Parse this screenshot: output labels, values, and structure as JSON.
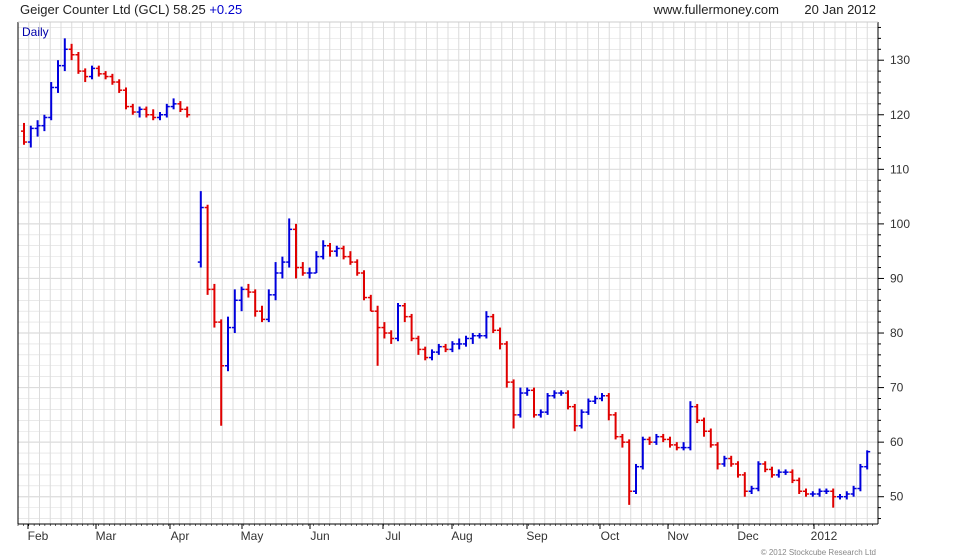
{
  "header": {
    "title": "Geiger Counter Ltd (GCL) 58.25",
    "change": "+0.25",
    "site": "www.fullermoney.com",
    "date": "20 Jan 2012"
  },
  "period_label": "Daily",
  "copyright": "© 2012 Stockcube Research Ltd",
  "colors": {
    "up": "#0000dd",
    "down": "#e00000",
    "grid": "#dcdcdc",
    "axis": "#000000",
    "label": "#0000aa"
  },
  "chart_data": {
    "type": "line",
    "style": "ohlc-bars",
    "period": "Daily",
    "x_tick_labels": [
      "Feb",
      "Mar",
      "Apr",
      "May",
      "Jun",
      "Jul",
      "Aug",
      "Sep",
      "Oct",
      "Nov",
      "Dec",
      "2012"
    ],
    "y_ticks": [
      50,
      60,
      70,
      80,
      90,
      100,
      110,
      120,
      130
    ],
    "ylim": [
      45,
      137
    ],
    "grid": true,
    "series": [
      {
        "values": [
          [
            0,
            117,
            118.5,
            114.5,
            115
          ],
          [
            1,
            115,
            118,
            114,
            117.5
          ],
          [
            2,
            117.5,
            119,
            116,
            118
          ],
          [
            3,
            118,
            120,
            117,
            119.5
          ],
          [
            4,
            119.5,
            126,
            119,
            125
          ],
          [
            5,
            125,
            130,
            124,
            129
          ],
          [
            6,
            129,
            134,
            128,
            132
          ],
          [
            7,
            132,
            133,
            130,
            131
          ],
          [
            8,
            131,
            131.5,
            127.5,
            128
          ],
          [
            9,
            128,
            128.5,
            126,
            127
          ],
          [
            10,
            127,
            129,
            126.5,
            128.5
          ],
          [
            11,
            128.5,
            129,
            127,
            127.5
          ],
          [
            12,
            127.5,
            128,
            126.5,
            127
          ],
          [
            13,
            127,
            127.5,
            125.5,
            126
          ],
          [
            14,
            126,
            126.5,
            124,
            124.5
          ],
          [
            15,
            124.5,
            125,
            121,
            121.5
          ],
          [
            16,
            121.5,
            122,
            120,
            120.5
          ],
          [
            17,
            120.5,
            121.5,
            119.5,
            121
          ],
          [
            18,
            121,
            121.5,
            119.5,
            120
          ],
          [
            19,
            120,
            121,
            119,
            119.5
          ],
          [
            20,
            119.5,
            120.5,
            119,
            120
          ],
          [
            21,
            120,
            122,
            119.5,
            121.5
          ],
          [
            22,
            121.5,
            123,
            121,
            122
          ],
          [
            23,
            122,
            122.5,
            120.5,
            121
          ],
          [
            24,
            121,
            121.5,
            119.5,
            120
          ],
          [
            26,
            93,
            106,
            92,
            103
          ],
          [
            27,
            103,
            103.5,
            87,
            88
          ],
          [
            28,
            88,
            89,
            81,
            82
          ],
          [
            29,
            82,
            82.5,
            63,
            74
          ],
          [
            30,
            74,
            83,
            73,
            81
          ],
          [
            31,
            81,
            88,
            80,
            86
          ],
          [
            32,
            86,
            88.5,
            84,
            88
          ],
          [
            33,
            88,
            89,
            86.5,
            87.5
          ],
          [
            34,
            87.5,
            88,
            83,
            84
          ],
          [
            35,
            84,
            85,
            82,
            82.5
          ],
          [
            36,
            82.5,
            88,
            82,
            87
          ],
          [
            37,
            87,
            93,
            86,
            91
          ],
          [
            38,
            91,
            94,
            90,
            93
          ],
          [
            39,
            93,
            101,
            92,
            99
          ],
          [
            40,
            99,
            100,
            90,
            92
          ],
          [
            41,
            92,
            93,
            90.5,
            91
          ],
          [
            42,
            91,
            92,
            90,
            91
          ],
          [
            43,
            91,
            95,
            91,
            94
          ],
          [
            44,
            94,
            97,
            93.5,
            96
          ],
          [
            45,
            96,
            96.5,
            94,
            95
          ],
          [
            46,
            95,
            96,
            94,
            95.5
          ],
          [
            47,
            95.5,
            96,
            93.5,
            94
          ],
          [
            48,
            94,
            95,
            92.5,
            93
          ],
          [
            49,
            93,
            93.5,
            90.5,
            91
          ],
          [
            50,
            91,
            91.5,
            86,
            86.5
          ],
          [
            51,
            86.5,
            87,
            84,
            84
          ],
          [
            52,
            84,
            85,
            74,
            81
          ],
          [
            53,
            81,
            82,
            79,
            80
          ],
          [
            54,
            80,
            80.5,
            78,
            79
          ],
          [
            55,
            79,
            85.5,
            78.5,
            85
          ],
          [
            56,
            85,
            85.5,
            82,
            83
          ],
          [
            57,
            83,
            83.5,
            78.5,
            79
          ],
          [
            58,
            79,
            79.5,
            76,
            77
          ],
          [
            59,
            77,
            77.5,
            75,
            75.5
          ],
          [
            60,
            75.5,
            77,
            75,
            76.5
          ],
          [
            61,
            76.5,
            78,
            76,
            77.5
          ],
          [
            62,
            77.5,
            78,
            76.5,
            77
          ],
          [
            63,
            77,
            78.5,
            76.5,
            78
          ],
          [
            64,
            78,
            79,
            77,
            78
          ],
          [
            65,
            78,
            79.5,
            77.5,
            79
          ],
          [
            66,
            79,
            80,
            78,
            79.5
          ],
          [
            67,
            79.5,
            80,
            79,
            79.5
          ],
          [
            68,
            79.5,
            84,
            79,
            83
          ],
          [
            69,
            83,
            83.5,
            80,
            80.5
          ],
          [
            70,
            80.5,
            81,
            77,
            78
          ],
          [
            71,
            78,
            78.5,
            70,
            71
          ],
          [
            72,
            71,
            71.5,
            62.5,
            65
          ],
          [
            73,
            65,
            70,
            64.5,
            69
          ],
          [
            74,
            69,
            70,
            68.5,
            69.5
          ],
          [
            75,
            69.5,
            70,
            64.5,
            65
          ],
          [
            76,
            65,
            66,
            64.5,
            65.5
          ],
          [
            77,
            65.5,
            69,
            65,
            68.5
          ],
          [
            78,
            68.5,
            69.5,
            68,
            69
          ],
          [
            79,
            69,
            69.5,
            68.5,
            69
          ],
          [
            80,
            69,
            69.5,
            66,
            66.5
          ],
          [
            81,
            66.5,
            67,
            62,
            63
          ],
          [
            82,
            63,
            66,
            62.5,
            65.5
          ],
          [
            83,
            65.5,
            68,
            65,
            67.5
          ],
          [
            84,
            67.5,
            68.5,
            67,
            68
          ],
          [
            85,
            68,
            69,
            67.5,
            68.5
          ],
          [
            86,
            68.5,
            69,
            64,
            65
          ],
          [
            87,
            65,
            65.5,
            60.5,
            61
          ],
          [
            88,
            61,
            61.5,
            59,
            60
          ],
          [
            89,
            60,
            60.5,
            48.5,
            51
          ],
          [
            90,
            51,
            56,
            50.5,
            55.5
          ],
          [
            91,
            55.5,
            61,
            55,
            60.5
          ],
          [
            92,
            60.5,
            61,
            59.5,
            60
          ],
          [
            93,
            60,
            61.5,
            59.5,
            61
          ],
          [
            94,
            61,
            61.5,
            60,
            60.5
          ],
          [
            95,
            60.5,
            61,
            59,
            59.5
          ],
          [
            96,
            59.5,
            60,
            58.5,
            59
          ],
          [
            97,
            59,
            60,
            58.5,
            59
          ],
          [
            98,
            59,
            67.5,
            58.5,
            66.5
          ],
          [
            99,
            66.5,
            67,
            63.5,
            64
          ],
          [
            100,
            64,
            64.5,
            61,
            62
          ],
          [
            101,
            62,
            62.5,
            59,
            59.5
          ],
          [
            102,
            59.5,
            60,
            55,
            56
          ],
          [
            103,
            56,
            57.5,
            55.5,
            57
          ],
          [
            104,
            57,
            57.5,
            55.5,
            56
          ],
          [
            105,
            56,
            56.5,
            53.5,
            54
          ],
          [
            106,
            54,
            54.5,
            50,
            51
          ],
          [
            107,
            51,
            52,
            50.5,
            51.5
          ],
          [
            108,
            51.5,
            56.5,
            51,
            56
          ],
          [
            109,
            56,
            56.5,
            54.5,
            55
          ],
          [
            110,
            55,
            55.5,
            53.5,
            54
          ],
          [
            111,
            54,
            55,
            53.5,
            54.5
          ],
          [
            112,
            54.5,
            55,
            54,
            54.5
          ],
          [
            113,
            54.5,
            55,
            52.5,
            53
          ],
          [
            114,
            53,
            53.5,
            50.5,
            51
          ],
          [
            115,
            51,
            51.5,
            50,
            50.5
          ],
          [
            116,
            50.5,
            51,
            50,
            50.5
          ],
          [
            117,
            50.5,
            51.5,
            50,
            51
          ],
          [
            118,
            51,
            51.5,
            50.5,
            51
          ],
          [
            119,
            51,
            51.5,
            48,
            50
          ],
          [
            120,
            50,
            50.5,
            49.5,
            50
          ],
          [
            121,
            50,
            51,
            49.5,
            50.5
          ],
          [
            122,
            50.5,
            52,
            50,
            51.5
          ],
          [
            123,
            51.5,
            56,
            51,
            55.5
          ],
          [
            124,
            55.5,
            58.5,
            55,
            58.25
          ]
        ]
      }
    ]
  }
}
